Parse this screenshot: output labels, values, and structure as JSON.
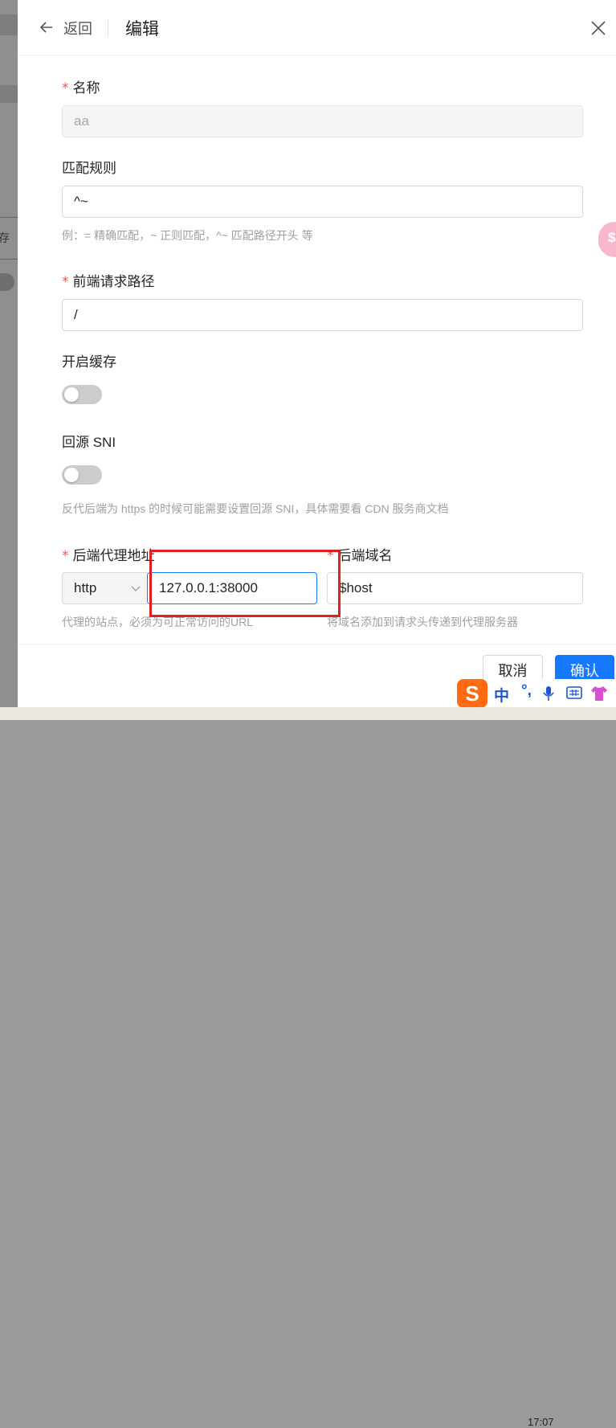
{
  "header": {
    "back_label": "返回",
    "title": "编辑"
  },
  "form": {
    "name": {
      "label": "名称",
      "value": "aa"
    },
    "match_rule": {
      "label": "匹配规则",
      "value": "^~",
      "help": "例：= 精确匹配，~ 正则匹配，^~ 匹配路径开头 等"
    },
    "frontend_path": {
      "label": "前端请求路径",
      "value": "/"
    },
    "enable_cache": {
      "label": "开启缓存",
      "on": false
    },
    "origin_sni": {
      "label": "回源 SNI",
      "on": false,
      "help": "反代后端为 https 的时候可能需要设置回源 SNI，具体需要看 CDN 服务商文档"
    },
    "backend_address": {
      "label": "后端代理地址",
      "protocol": "http",
      "value": "127.0.0.1:38000",
      "help": "代理的站点，必须为可正常访问的URL"
    },
    "backend_host": {
      "label": "后端域名",
      "value": "$host",
      "help": "将域名添加到请求头传递到代理服务器"
    }
  },
  "footer": {
    "cancel_label": "取消",
    "ok_label": "确认"
  },
  "ime": {
    "logo": "S",
    "lang": "中",
    "punct": "°,"
  },
  "floating_badge": {
    "glyph": "$"
  },
  "taskbar": {
    "time": "17:07"
  },
  "background": {
    "side_char": "存"
  }
}
